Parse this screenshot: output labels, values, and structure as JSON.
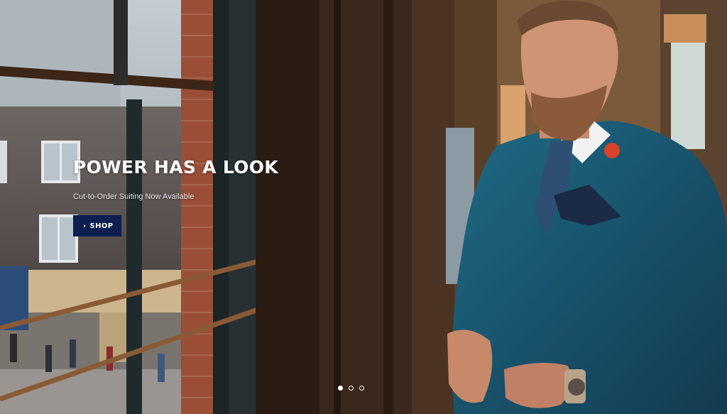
{
  "hero": {
    "title": "POWER HAS A LOOK",
    "subtitle": "Cut-to-Order Suiting Now Available",
    "cta_label": "SHOP",
    "cta_icon": "chevron-right-icon"
  },
  "carousel": {
    "slide_count": 3,
    "active_index": 0
  },
  "colors": {
    "cta_background": "#0d1f4f",
    "title": "#ffffff",
    "suit": "#1d5670"
  }
}
